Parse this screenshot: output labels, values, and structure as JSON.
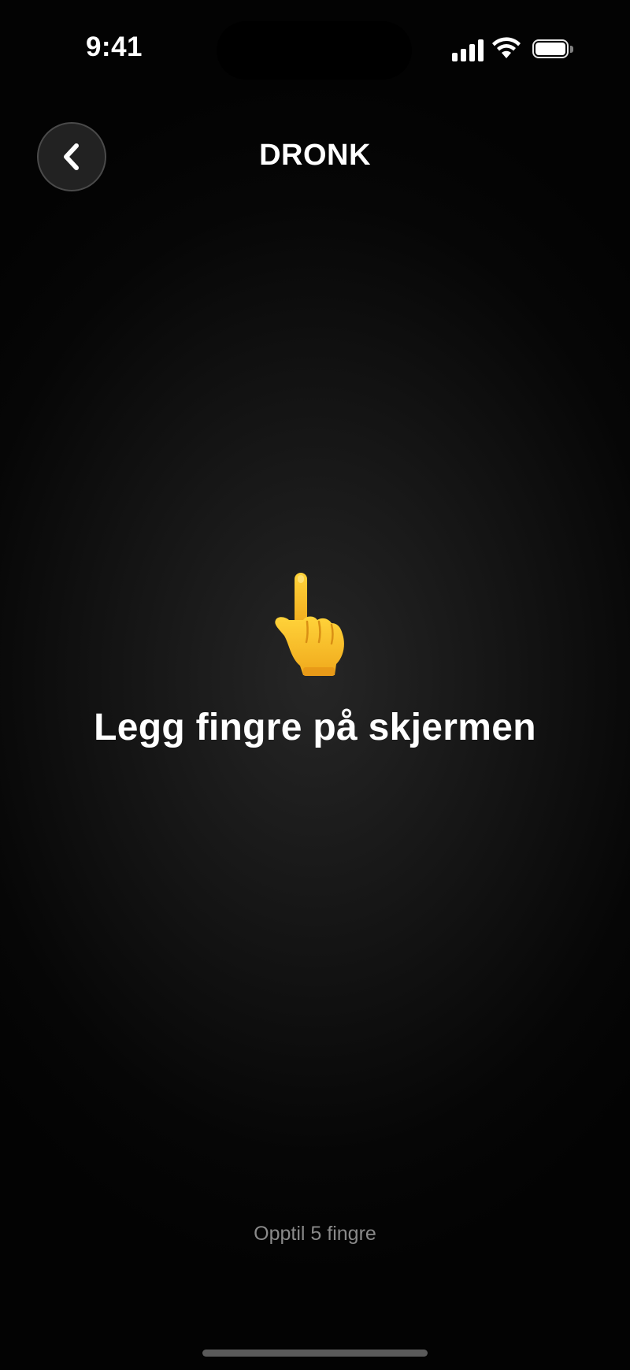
{
  "status_bar": {
    "time": "9:41",
    "signal_icon": "cellular-signal-icon",
    "wifi_icon": "wifi-icon",
    "battery_icon": "battery-icon",
    "battery_level": 1.0
  },
  "header": {
    "back_icon": "chevron-left-icon",
    "title": "DRONK"
  },
  "main": {
    "icon": "pointing-up-hand-icon",
    "prompt": "Legg fingre på skjermen",
    "hint": "Opptil 5 fingre"
  },
  "colors": {
    "background": "#000000",
    "hand_skin": "#F7C12A",
    "hint_text": "#8A8A8A"
  }
}
